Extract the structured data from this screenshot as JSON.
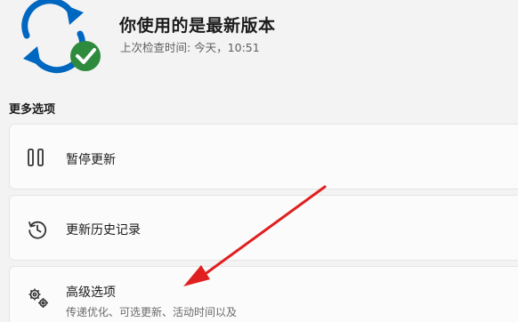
{
  "status": {
    "title": "你使用的是最新版本",
    "last_checked": "上次检查时间: 今天，10:51",
    "icon": "sync-check-icon",
    "colors": {
      "sync_arrows": "#0067c0",
      "check_badge": "#2e8b3d"
    }
  },
  "more_options": {
    "section_label": "更多选项",
    "items": [
      {
        "label": "暂停更新",
        "icon": "pause-icon"
      },
      {
        "label": "更新历史记录",
        "icon": "history-icon"
      },
      {
        "label": "高级选项",
        "description": "传递优化、可选更新、活动时间以及",
        "icon": "gears-icon"
      }
    ]
  },
  "annotation": {
    "icon": "red-arrow",
    "color": "#e02020"
  }
}
